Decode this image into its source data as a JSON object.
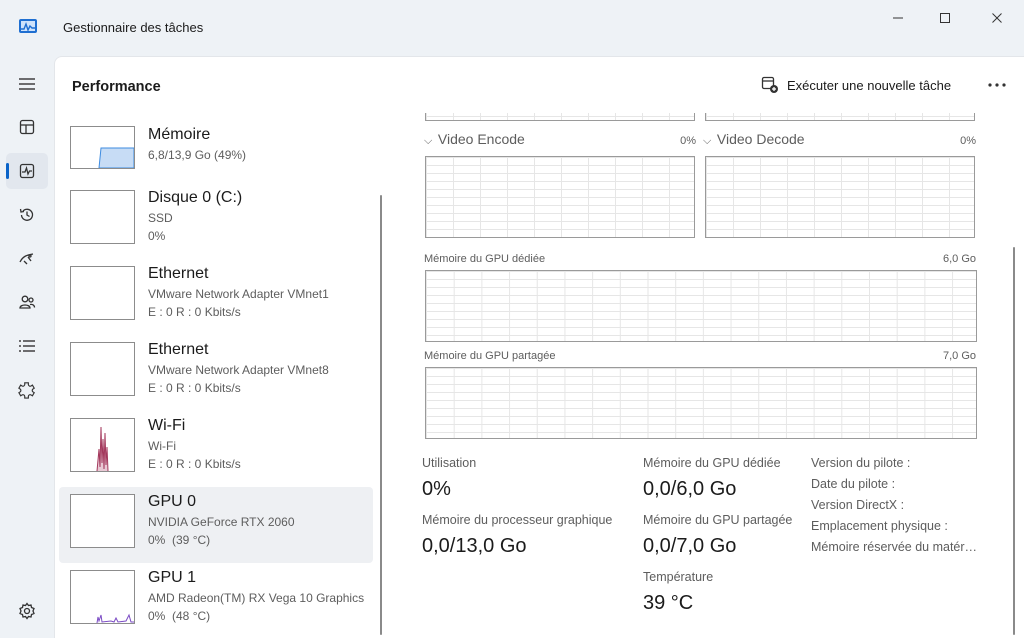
{
  "window": {
    "title": "Gestionnaire des tâches",
    "minimize_icon": "minimize-icon",
    "maximize_icon": "maximize-icon",
    "close_icon": "close-icon"
  },
  "nav": {
    "items": [
      {
        "icon": "hamburger-icon"
      },
      {
        "icon": "processes-icon"
      },
      {
        "icon": "performance-icon",
        "active": true
      },
      {
        "icon": "history-icon"
      },
      {
        "icon": "startup-icon"
      },
      {
        "icon": "users-icon"
      },
      {
        "icon": "details-icon"
      },
      {
        "icon": "services-icon"
      },
      {
        "icon": "settings-icon"
      }
    ]
  },
  "header": {
    "title": "Performance",
    "run_task_label": "Exécuter une nouvelle tâche",
    "more_icon": "more-icon"
  },
  "devices": [
    {
      "name": "Mémoire",
      "sub1": "6,8/13,9 Go (49%)",
      "sub2": "",
      "usage": 0.49
    },
    {
      "name": "Disque 0 (C:)",
      "sub1": "SSD",
      "sub2": "0%"
    },
    {
      "name": "Ethernet",
      "sub1": "VMware Network Adapter VMnet1",
      "sub2": "E : 0 R : 0 Kbits/s"
    },
    {
      "name": "Ethernet",
      "sub1": "VMware Network Adapter VMnet8",
      "sub2": "E : 0 R : 0 Kbits/s"
    },
    {
      "name": "Wi-Fi",
      "sub1": "Wi-Fi",
      "sub2": "E : 0 R : 0 Kbits/s"
    },
    {
      "name": "GPU 0",
      "sub1": "NVIDIA GeForce RTX 2060",
      "sub2": "0%  (39 °C)",
      "selected": true
    },
    {
      "name": "GPU 1",
      "sub1": "AMD Radeon(TM) RX Vega 10 Graphics",
      "sub2": "0%  (48 °C)"
    }
  ],
  "detail": {
    "video_encode": {
      "label": "Video Encode",
      "value": "0%"
    },
    "video_decode": {
      "label": "Video Decode",
      "value": "0%"
    },
    "dedicated_mem": {
      "label": "Mémoire du GPU dédiée",
      "max": "6,0 Go"
    },
    "shared_mem": {
      "label": "Mémoire du GPU partagée",
      "max": "7,0 Go"
    },
    "stats": {
      "utilisation_label": "Utilisation",
      "utilisation_value": "0%",
      "gpu_proc_mem_label": "Mémoire du processeur graphique",
      "gpu_proc_mem_value": "0,0/13,0 Go",
      "dedicated_label": "Mémoire du GPU dédiée",
      "dedicated_value": "0,0/6,0 Go",
      "shared_label": "Mémoire du GPU partagée",
      "shared_value": "0,0/7,0 Go",
      "temp_label": "Température",
      "temp_value": "39 °C",
      "driver_version_label": "Version du pilote :",
      "driver_date_label": "Date du pilote :",
      "directx_label": "Version DirectX :",
      "location_label": "Emplacement physique :",
      "reserved_mem_label": "Mémoire réservée du matér…"
    }
  },
  "colors": {
    "accent": "#0a63c8",
    "memory_fill": "#c7dcf5",
    "memory_line": "#3d8be0",
    "wifi_line": "#a3385c",
    "gpu1_line": "#7b4bc4"
  }
}
